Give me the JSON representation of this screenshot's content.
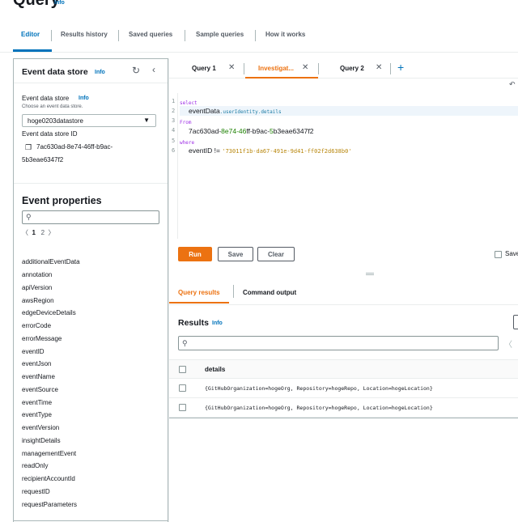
{
  "header": {
    "title": "Query",
    "info": "Info"
  },
  "top_tabs": [
    "Editor",
    "Results history",
    "Saved queries",
    "Sample queries",
    "How it works"
  ],
  "left_panel": {
    "title": "Event data store",
    "info": "Info",
    "refresh_icon": "refresh-icon",
    "collapse_icon": "chevron-left-icon",
    "data_store": {
      "label": "Event data store",
      "info": "Info",
      "description": "Choose an event data store.",
      "selected": "hoge0203datastore",
      "id_label": "Event data store ID",
      "id_line1": "7ac630ad-8e74-46ff-b9ac-",
      "id_line2": "5b3eae6347f2"
    },
    "event_properties": {
      "title": "Event properties",
      "search_placeholder": "",
      "pagination": {
        "current": "1",
        "next": "2"
      },
      "items": [
        "additionalEventData",
        "annotation",
        "apiVersion",
        "awsRegion",
        "edgeDeviceDetails",
        "errorCode",
        "errorMessage",
        "eventID",
        "eventJson",
        "eventName",
        "eventSource",
        "eventTime",
        "eventType",
        "eventVersion",
        "insightDetails",
        "managementEvent",
        "readOnly",
        "recipientAccountId",
        "requestID",
        "requestParameters"
      ]
    }
  },
  "editor": {
    "tabs": [
      {
        "label": "Query 1",
        "active": false
      },
      {
        "label": "Investigat...",
        "active": true
      },
      {
        "label": "Query 2",
        "active": false
      }
    ],
    "code": {
      "line_numbers": [
        "1",
        "2",
        "3",
        "4",
        "5",
        "6"
      ],
      "l1_kw": "select",
      "l2_big": "eventData",
      "l2_small": ".userIdentity.details",
      "l3_kw": "From",
      "l4_a": "7ac630ad-",
      "l4_b": "8e74-46",
      "l4_c": "ff-b9ac-",
      "l4_d": "5",
      "l4_e": "b3eae6347f2",
      "l5_kw": "where",
      "l6_field": "eventID",
      "l6_op": " != ",
      "l6_str": "'73011f1b-da67-491e-9d41-ff02f2d638b0'"
    },
    "buttons": {
      "run": "Run",
      "save": "Save",
      "clear": "Clear"
    },
    "save_results_label": "Save"
  },
  "results_tabs": [
    "Query results",
    "Command output"
  ],
  "results": {
    "title": "Results",
    "info": "Info",
    "column": "details",
    "rows": [
      "{GitHubOrganization=hogeOrg, Repository=hogeRepo, Location=hogeLocation}",
      "{GitHubOrganization=hogeOrg, Repository=hogeRepo, Location=hogeLocation}"
    ]
  },
  "colors": {
    "link": "#0073bb",
    "accent": "#ec7211",
    "keyword": "#9e2fe6"
  }
}
